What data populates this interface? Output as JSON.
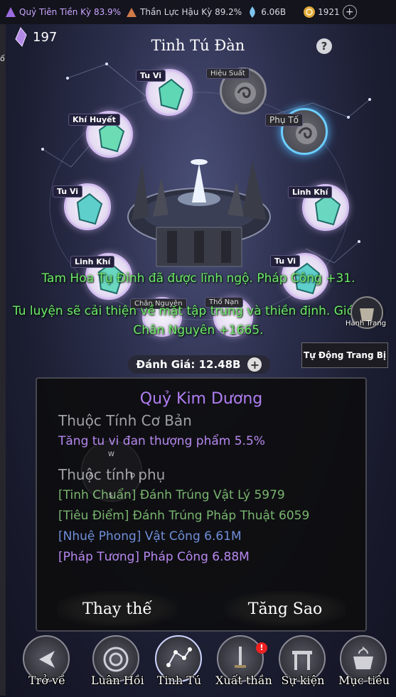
{
  "topbar": {
    "stat1": "Quỷ Tiên Tiền Kỳ 83.9%",
    "stat2": "Thần Lực Hậu Kỳ 89.2%",
    "stat3": "6.06B",
    "stat4": "1921",
    "plus": "+"
  },
  "side_text": "ố",
  "crystal_count": "197",
  "title": "Tinh Tú Đàn",
  "help": "?",
  "nodes": {
    "tu_vi_top": "Tu Vi",
    "hieu_suat": "Hiệu Suất",
    "khi_huyet": "Khí Huyết",
    "phu_to": "Phụ Tố",
    "tu_vi_left": "Tu Vi",
    "linh_khi_right": "Linh Khí",
    "linh_khi_left": "Linh Khí",
    "tu_vi_right": "Tu Vi",
    "chan_nguyen": "Chân Nguyên",
    "tho_nan": "Thổ Nạn"
  },
  "messages": {
    "line1": "Tam Hoa Tụ Đỉnh đã được lĩnh ngộ. Pháp Công +31.",
    "line2": "Tu luyện sẽ cải thiện về mặt tập trung và thiền định. Giới hạn Chân Nguyên +1665."
  },
  "hanh_trang": "Hành Trang",
  "auto_equip": "Tự Động Trang Bị",
  "rating": "Đánh Giá: 12.48B",
  "rating_plus": "+",
  "panel": {
    "name": "Quỷ Kim Dương",
    "base_heading": "Thuộc Tính Cơ Bản",
    "base_value": "Tăng tu vi đan thượng phẩm 5.5%",
    "sub_heading": "Thuộc tính phụ",
    "subs": [
      "[Tinh Chuẩn] Đánh Trúng Vật Lý 5979",
      "[Tiêu Điểm] Đánh Trúng Pháp Thuật 6059",
      "[Nhuệ Phong] Vật Công 6.61M",
      "[Pháp Tương] Pháp Công 6.88M"
    ]
  },
  "joystick": {
    "w": "W",
    "a": "A",
    "s": "S",
    "d": "D"
  },
  "buttons": {
    "replace": "Thay thế",
    "upgrade": "Tăng Sao"
  },
  "nav": {
    "back": "Trở về",
    "luan_hoi": "Luân Hồi",
    "tinh_tu": "Tinh Tú",
    "xuat_than": "Xuất thần",
    "su_kien": "Sự kiện",
    "muc_tieu": "Mục tiêu"
  },
  "badge": "!",
  "colors": {
    "accent_purple": "#b07ef2",
    "message_green": "#6fe86b",
    "sub_green": "#79b56f",
    "sub_blue": "#6f8fd9"
  }
}
